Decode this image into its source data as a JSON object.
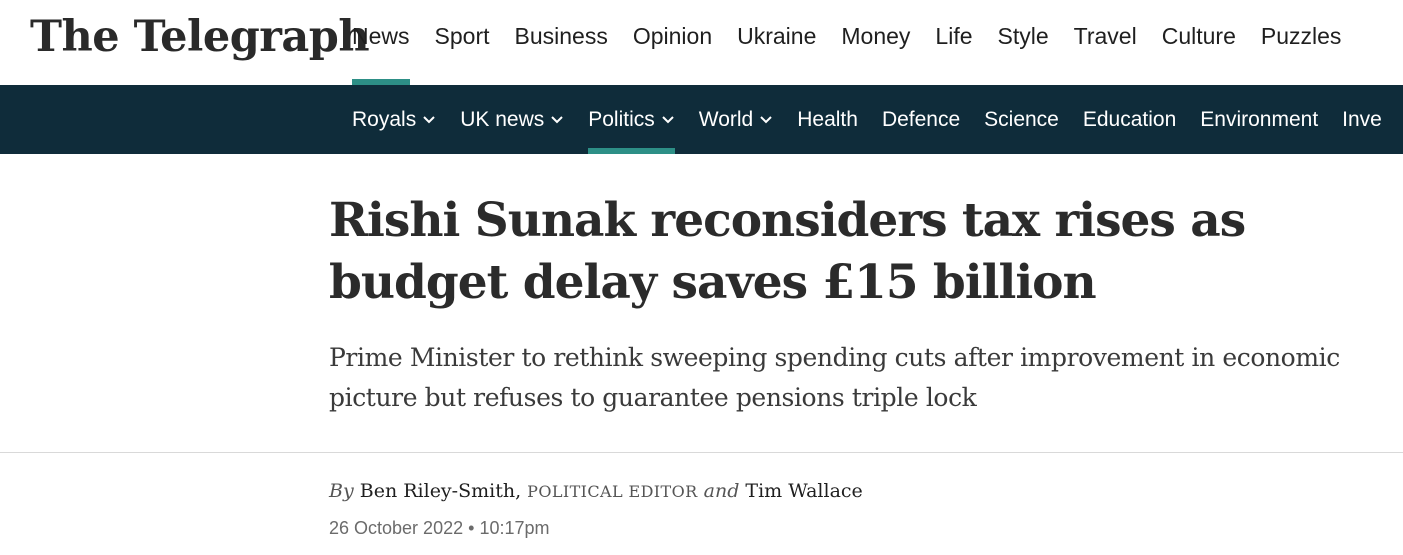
{
  "brand": {
    "logo_text": "The Telegraph"
  },
  "primary_nav": [
    {
      "label": "News",
      "active": true
    },
    {
      "label": "Sport"
    },
    {
      "label": "Business"
    },
    {
      "label": "Opinion"
    },
    {
      "label": "Ukraine"
    },
    {
      "label": "Money"
    },
    {
      "label": "Life"
    },
    {
      "label": "Style"
    },
    {
      "label": "Travel"
    },
    {
      "label": "Culture"
    },
    {
      "label": "Puzzles"
    }
  ],
  "sub_nav": [
    {
      "label": "Royals",
      "dropdown": true
    },
    {
      "label": "UK news",
      "dropdown": true
    },
    {
      "label": "Politics",
      "dropdown": true,
      "active": true
    },
    {
      "label": "World",
      "dropdown": true
    },
    {
      "label": "Health"
    },
    {
      "label": "Defence"
    },
    {
      "label": "Science"
    },
    {
      "label": "Education"
    },
    {
      "label": "Environment"
    },
    {
      "label": "Inve"
    }
  ],
  "article": {
    "headline": "Rishi Sunak reconsiders tax rises as budget delay saves £15 billion",
    "standfirst": "Prime Minister to rethink sweeping spending cuts after improvement in economic picture but refuses to guarantee pensions triple lock",
    "byline": {
      "by": "By",
      "author1": "Ben Riley-Smith,",
      "role": "POLITICAL EDITOR",
      "and": "and",
      "author2": "Tim Wallace"
    },
    "date": "26 October 2022",
    "separator": "•",
    "time": "10:17pm"
  },
  "colors": {
    "subnav_bg": "#0f2c3a",
    "accent": "#2d8f86",
    "text": "#2b2b2b"
  }
}
